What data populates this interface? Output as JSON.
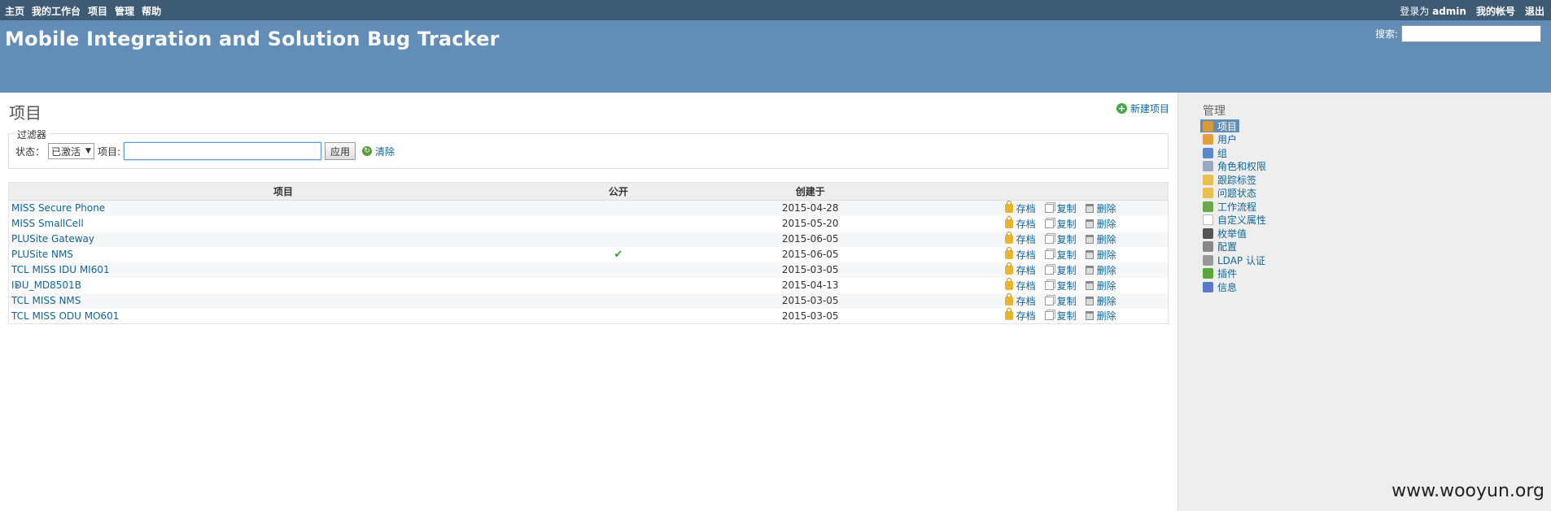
{
  "top_menu": {
    "items": [
      "主页",
      "我的工作台",
      "项目",
      "管理",
      "帮助"
    ],
    "login_prefix": "登录为",
    "login_user": "admin",
    "my_account": "我的帐号",
    "logout": "退出"
  },
  "header": {
    "title": "Mobile Integration and Solution Bug Tracker",
    "search_label": "搜索:"
  },
  "page": {
    "title": "项目",
    "new_project": "新建项目"
  },
  "filters": {
    "legend": "过滤器",
    "status_label": "状态：",
    "status_value": "已激活",
    "project_label": "项目:",
    "apply": "应用",
    "clear": "清除"
  },
  "table": {
    "headers": {
      "name": "项目",
      "public": "公开",
      "created": "创建于"
    },
    "rows": [
      {
        "name": "MISS Secure Phone",
        "public": false,
        "created": "2015-04-28",
        "child": false
      },
      {
        "name": "MISS SmallCell",
        "public": false,
        "created": "2015-05-20",
        "child": false
      },
      {
        "name": "PLUSite Gateway",
        "public": false,
        "created": "2015-06-05",
        "child": false
      },
      {
        "name": "PLUSite NMS",
        "public": true,
        "created": "2015-06-05",
        "child": false
      },
      {
        "name": "TCL MISS IDU MI601",
        "public": false,
        "created": "2015-03-05",
        "child": false
      },
      {
        "name": "IDU_MD8501B",
        "public": false,
        "created": "2015-04-13",
        "child": true
      },
      {
        "name": "TCL MISS NMS",
        "public": false,
        "created": "2015-03-05",
        "child": false
      },
      {
        "name": "TCL MISS ODU MO601",
        "public": false,
        "created": "2015-03-05",
        "child": false
      }
    ],
    "actions": {
      "archive": "存档",
      "copy": "复制",
      "delete": "删除"
    }
  },
  "sidebar": {
    "title": "管理",
    "items": [
      {
        "label": "项目",
        "icon": "projects-icon",
        "color": "#d99a3a",
        "selected": true
      },
      {
        "label": "用户",
        "icon": "user-icon",
        "color": "#e0a040",
        "selected": false
      },
      {
        "label": "组",
        "icon": "group-icon",
        "color": "#5a88c8",
        "selected": false
      },
      {
        "label": "角色和权限",
        "icon": "roles-icon",
        "color": "#9aa8c0",
        "selected": false
      },
      {
        "label": "跟踪标签",
        "icon": "tracker-icon",
        "color": "#e8c050",
        "selected": false
      },
      {
        "label": "问题状态",
        "icon": "status-icon",
        "color": "#e8c050",
        "selected": false
      },
      {
        "label": "工作流程",
        "icon": "workflow-icon",
        "color": "#6aa84a",
        "selected": false
      },
      {
        "label": "自定义属性",
        "icon": "custom-field-icon",
        "color": "#ffffff",
        "selected": false
      },
      {
        "label": "枚举值",
        "icon": "list-icon",
        "color": "#555555",
        "selected": false
      },
      {
        "label": "配置",
        "icon": "gear-icon",
        "color": "#888888",
        "selected": false
      },
      {
        "label": "LDAP 认证",
        "icon": "ldap-icon",
        "color": "#999999",
        "selected": false
      },
      {
        "label": "插件",
        "icon": "plugin-icon",
        "color": "#5aa83a",
        "selected": false
      },
      {
        "label": "信息",
        "icon": "info-icon",
        "color": "#5a7ac8",
        "selected": false
      }
    ]
  },
  "watermark": "www.wooyun.org"
}
